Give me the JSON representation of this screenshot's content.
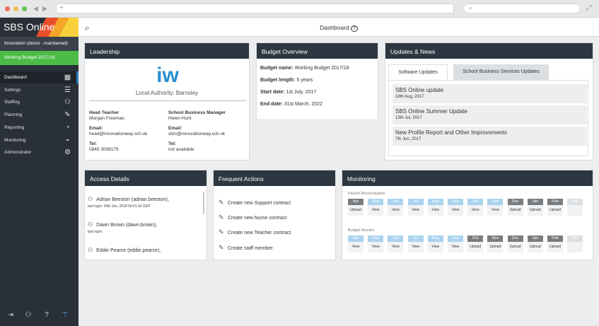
{
  "browser": {
    "url_placeholder": "+"
  },
  "app": {
    "logo": "SBS Online",
    "org": "Innovation (demo - maintained)",
    "budget": "Working Budget 2017/18"
  },
  "nav": [
    {
      "label": "Dashboard",
      "icon": "dashboard-icon",
      "glyph": "▦"
    },
    {
      "label": "Settings",
      "icon": "sliders-icon",
      "glyph": "☰"
    },
    {
      "label": "Staffing",
      "icon": "people-icon",
      "glyph": "⚇"
    },
    {
      "label": "Planning",
      "icon": "edit-icon",
      "glyph": "✎"
    },
    {
      "label": "Reporting",
      "icon": "pie-icon",
      "glyph": "◔"
    },
    {
      "label": "Monitoring",
      "icon": "line-chart-icon",
      "glyph": "⌁"
    },
    {
      "label": "Administrator",
      "icon": "user-settings-icon",
      "glyph": "⚙"
    }
  ],
  "topbar": {
    "title": "Dashboard"
  },
  "leadership": {
    "title": "Leadership",
    "logo_text": "iw",
    "authority": "Local Authority: Barnsley",
    "head_role": "Head Teacher",
    "head_name": "Morgan Freeman",
    "head_email_label": "Email:",
    "head_email": "head@innovationway.sch.uk",
    "head_tel_label": "Tel:",
    "head_tel": "0845 3008179",
    "sbm_role": "School Business Manager",
    "sbm_name": "Helen Hunt",
    "sbm_email_label": "Email:",
    "sbm_email": "sbm@innovationway.sch.uk",
    "sbm_tel_label": "Tel:",
    "sbm_tel": "not available"
  },
  "overview": {
    "title": "Budget Overview",
    "name_label": "Budget name:",
    "name": "Working Budget 2017/18",
    "length_label": "Budget length:",
    "length": "5 years",
    "start_label": "Start date:",
    "start": "1st July, 2017",
    "end_label": "End date:",
    "end": "31st March, 2022"
  },
  "news": {
    "title": "Updates & News",
    "tabs": [
      "Software Updates",
      "School Business Services Updates"
    ],
    "items": [
      {
        "title": "SBS Online update",
        "date": "18th Aug, 2017"
      },
      {
        "title": "SBS Online Summer Update",
        "date": "13th Jul, 2017"
      },
      {
        "title": "New Profile Report and Other Improvements",
        "date": "7th Jun, 2017"
      }
    ]
  },
  "access": {
    "title": "Access Details",
    "items": [
      {
        "name": "Adrian Beeston (adrian.beeston),",
        "login": "last login: 24th Jan, 2018 09:01:34 GMT"
      },
      {
        "name": "Dawn Brown (dawn.brown),",
        "login": "last login:"
      },
      {
        "name": "Eddie Pearce (eddie.pearce),",
        "login": ""
      }
    ]
  },
  "frequent": {
    "title": "Frequent Actions",
    "items": [
      "Create new Support contract",
      "Create new Nurse contract",
      "Create new Teacher contract",
      "Create staff member"
    ]
  },
  "monitoring": {
    "title": "Monitoring",
    "payroll_label": "Payroll Reconciliation",
    "budget_label": "Budget Monitor",
    "months": [
      "Apr",
      "May",
      "Jun",
      "Jul",
      "Aug",
      "Sep",
      "Oct",
      "Nov",
      "Dec",
      "Jan",
      "Feb",
      "Mar"
    ],
    "payroll": [
      {
        "state": "grey",
        "action": "Upload"
      },
      {
        "state": "blue",
        "action": "View"
      },
      {
        "state": "blue",
        "action": "View"
      },
      {
        "state": "blue",
        "action": "View"
      },
      {
        "state": "blue",
        "action": "View"
      },
      {
        "state": "blue",
        "action": "View"
      },
      {
        "state": "blue",
        "action": "View"
      },
      {
        "state": "blue",
        "action": "View"
      },
      {
        "state": "grey",
        "action": "Upload"
      },
      {
        "state": "grey",
        "action": "Upload"
      },
      {
        "state": "grey",
        "action": "Upload"
      },
      {
        "state": "light",
        "action": ""
      }
    ],
    "budget": [
      {
        "state": "blue",
        "action": "View"
      },
      {
        "state": "blue",
        "action": "View"
      },
      {
        "state": "blue",
        "action": "View"
      },
      {
        "state": "blue",
        "action": "View"
      },
      {
        "state": "blue",
        "action": "View"
      },
      {
        "state": "blue",
        "action": "View"
      },
      {
        "state": "grey",
        "action": "Upload"
      },
      {
        "state": "grey",
        "action": "Upload"
      },
      {
        "state": "grey",
        "action": "Upload"
      },
      {
        "state": "grey",
        "action": "Upload"
      },
      {
        "state": "grey",
        "action": "Upload"
      },
      {
        "state": "light",
        "action": ""
      }
    ],
    "colors": {
      "blue": "#a9d3ee",
      "grey": "#7a7d80",
      "light": "#dcdfe1"
    }
  }
}
